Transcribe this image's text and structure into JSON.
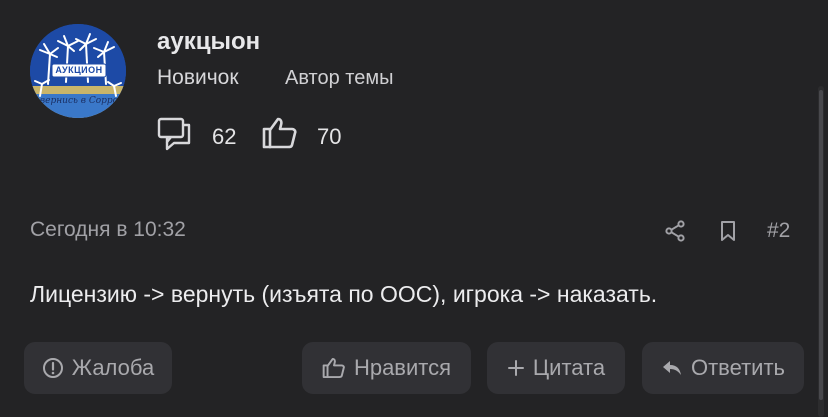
{
  "author": {
    "avatar_text": "АУКЦИОН",
    "avatar_script": "вернись в Сорро",
    "name": "аукцыон",
    "role": "Новичок",
    "badge": "Автор темы",
    "stats": {
      "messages": "62",
      "likes": "70"
    }
  },
  "post": {
    "date": "Сегодня в 10:32",
    "number": "#2",
    "content": "Лицензию -> вернуть (изъята по ООС), игрока -> наказать."
  },
  "actions": {
    "report": "Жалоба",
    "like": "Нравится",
    "quote": "Цитата",
    "reply": "Ответить"
  }
}
